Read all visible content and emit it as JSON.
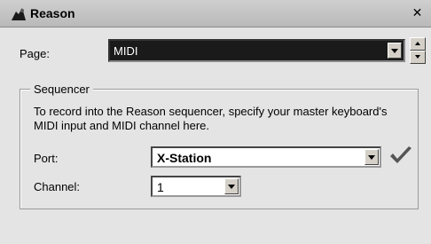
{
  "window": {
    "title": "Reason",
    "close_glyph": "✕"
  },
  "page": {
    "label": "Page:",
    "value": "MIDI"
  },
  "sequencer": {
    "legend": "Sequencer",
    "description": "To record into the Reason sequencer, specify your master keyboard's MIDI input and MIDI channel here.",
    "port": {
      "label": "Port:",
      "value": "X-Station"
    },
    "channel": {
      "label": "Channel:",
      "value": "1"
    }
  },
  "icons": {
    "app": "reason-app-icon",
    "confirm": "checkmark-icon",
    "dropdown": "chevron-down-icon"
  }
}
